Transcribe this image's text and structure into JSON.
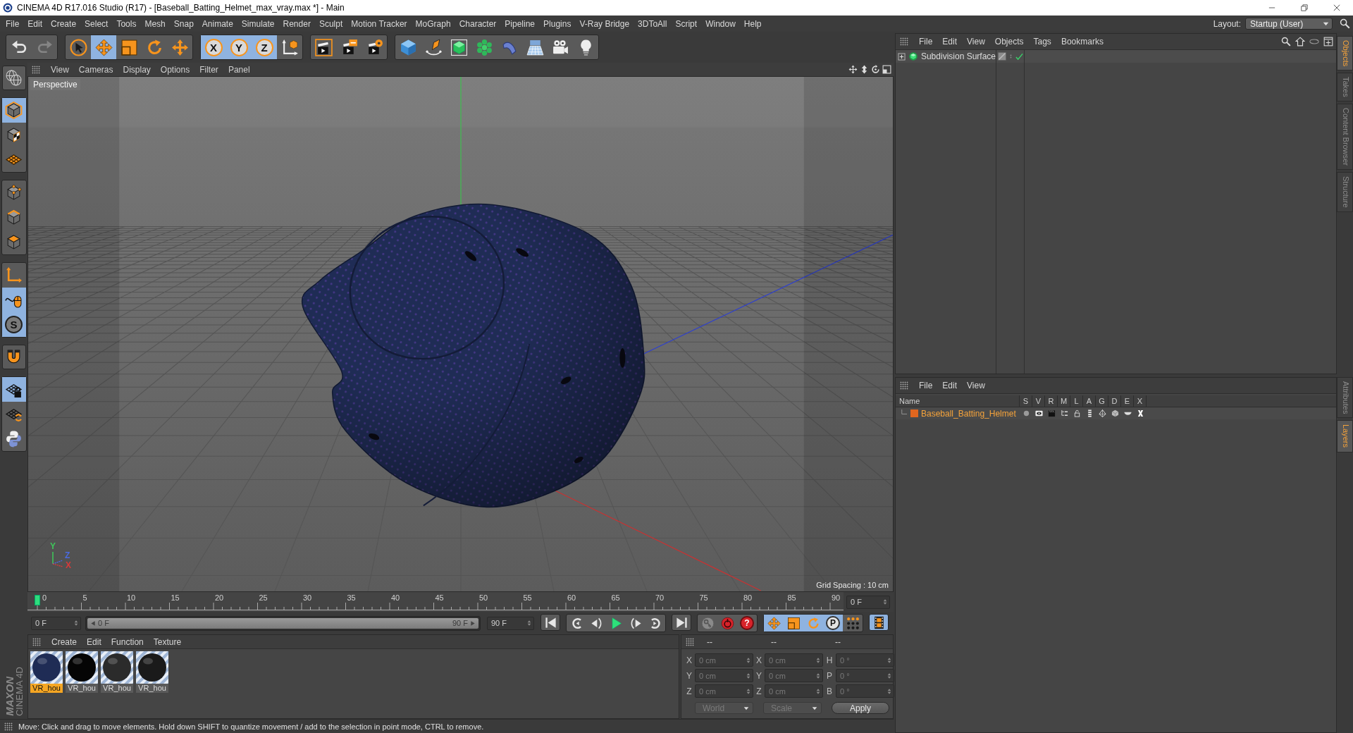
{
  "window": {
    "title": "CINEMA 4D R17.016 Studio (R17) - [Baseball_Batting_Helmet_max_vray.max *] - Main"
  },
  "menu_bar": {
    "items": [
      "File",
      "Edit",
      "Create",
      "Select",
      "Tools",
      "Mesh",
      "Snap",
      "Animate",
      "Simulate",
      "Render",
      "Sculpt",
      "Motion Tracker",
      "MoGraph",
      "Character",
      "Pipeline",
      "Plugins",
      "V-Ray Bridge",
      "3DToAll",
      "Script",
      "Window",
      "Help"
    ],
    "layout_label": "Layout:",
    "layout_value": "Startup (User)"
  },
  "toolbar": {
    "groups": [
      [
        {
          "kind": "undo",
          "selected": false,
          "disabled": false
        },
        {
          "kind": "redo",
          "selected": false,
          "disabled": true
        }
      ],
      [
        {
          "kind": "select",
          "selected": false,
          "disabled": false
        },
        {
          "kind": "move",
          "selected": true,
          "disabled": false
        },
        {
          "kind": "scale",
          "selected": false,
          "disabled": false
        },
        {
          "kind": "rotate",
          "selected": false,
          "disabled": false
        },
        {
          "kind": "transform",
          "selected": false,
          "disabled": false
        }
      ],
      [
        {
          "kind": "axis_x",
          "label": "X",
          "selected": true,
          "disabled": false
        },
        {
          "kind": "axis_y",
          "label": "Y",
          "selected": true,
          "disabled": false
        },
        {
          "kind": "axis_z",
          "label": "Z",
          "selected": true,
          "disabled": false
        },
        {
          "kind": "coords",
          "selected": false,
          "disabled": false
        }
      ],
      [
        {
          "kind": "render_view",
          "selected": false,
          "disabled": false
        },
        {
          "kind": "render_pv",
          "selected": false,
          "disabled": false
        },
        {
          "kind": "render_settings",
          "selected": false,
          "disabled": false
        }
      ],
      [
        {
          "kind": "cube",
          "selected": false,
          "disabled": false
        },
        {
          "kind": "pen",
          "selected": false,
          "disabled": false
        },
        {
          "kind": "subdivision",
          "selected": false,
          "disabled": false
        },
        {
          "kind": "cloner",
          "selected": false,
          "disabled": false
        },
        {
          "kind": "bend",
          "selected": false,
          "disabled": false
        },
        {
          "kind": "floor",
          "selected": false,
          "disabled": false
        },
        {
          "kind": "camera",
          "selected": false,
          "disabled": false
        },
        {
          "kind": "light",
          "selected": false,
          "disabled": false
        }
      ]
    ]
  },
  "left_toolbar": {
    "groups": [
      [
        {
          "kind": "world",
          "selected": false
        }
      ],
      [
        {
          "kind": "model",
          "selected": true
        },
        {
          "kind": "texture",
          "selected": false
        },
        {
          "kind": "workplane",
          "selected": false
        }
      ],
      [
        {
          "kind": "points",
          "selected": false
        },
        {
          "kind": "edges",
          "selected": false
        },
        {
          "kind": "polygons",
          "selected": false
        }
      ],
      [
        {
          "kind": "axis",
          "selected": false
        },
        {
          "kind": "tweak",
          "selected": true
        },
        {
          "kind": "snap",
          "label": "S",
          "selected": true
        }
      ],
      [
        {
          "kind": "magnet",
          "selected": false
        }
      ],
      [
        {
          "kind": "grid_lock",
          "selected": true
        },
        {
          "kind": "grid_sync",
          "selected": false
        },
        {
          "kind": "python",
          "selected": false
        }
      ]
    ]
  },
  "viewport": {
    "menu": [
      "View",
      "Cameras",
      "Display",
      "Options",
      "Filter",
      "Panel"
    ],
    "camera_label": "Perspective",
    "gizmo_labels": [
      "Y",
      "Z",
      "X"
    ],
    "grid_spacing": "Grid Spacing : 10 cm"
  },
  "timeline": {
    "labels": [
      "0",
      "5",
      "10",
      "15",
      "20",
      "25",
      "30",
      "35",
      "40",
      "45",
      "50",
      "55",
      "60",
      "65",
      "70",
      "75",
      "80",
      "85",
      "90"
    ],
    "playhead": {
      "level": 0
    },
    "current_frame": "0 F"
  },
  "playback": {
    "start_field": "0 F",
    "range": {
      "start": "0 F",
      "end": "90 F",
      "level": 1
    },
    "end_field": "90 F",
    "groups": [
      [
        {
          "kind": "first",
          "selected": false
        }
      ],
      [
        {
          "kind": "prev_key",
          "selected": false
        },
        {
          "kind": "prev_frame",
          "selected": false
        },
        {
          "kind": "play",
          "selected": false
        },
        {
          "kind": "next_frame",
          "selected": false
        },
        {
          "kind": "next_key",
          "selected": false
        }
      ],
      [
        {
          "kind": "last",
          "selected": false
        }
      ],
      [
        {
          "kind": "key_off",
          "selected": false
        },
        {
          "kind": "record",
          "selected": false
        },
        {
          "kind": "autokey",
          "label": "?",
          "selected": false
        }
      ],
      [
        {
          "kind": "key_move",
          "selected": true
        },
        {
          "kind": "key_scale",
          "selected": true
        },
        {
          "kind": "key_rotate",
          "selected": true
        },
        {
          "kind": "param",
          "label": "P",
          "selected": true
        },
        {
          "kind": "pla",
          "selected": false
        }
      ],
      [
        {
          "kind": "timeline",
          "selected": true
        }
      ]
    ]
  },
  "materials": {
    "menu": [
      "Create",
      "Edit",
      "Function",
      "Texture"
    ],
    "items": [
      {
        "name": "VR_hou",
        "color": "#1f2c55",
        "selected": true
      },
      {
        "name": "VR_hou",
        "color": "#050505",
        "selected": false
      },
      {
        "name": "VR_hou",
        "color": "#2b2b2b",
        "selected": false
      },
      {
        "name": "VR_hou",
        "color": "#1a1a1a",
        "selected": false
      }
    ]
  },
  "coordinates": {
    "headers": [
      "--",
      "--",
      "--"
    ],
    "disabled": true,
    "rows": [
      [
        {
          "label": "X",
          "value": "0 cm"
        },
        {
          "label": "X",
          "value": "0 cm"
        },
        {
          "label": "H",
          "value": "0 °"
        }
      ],
      [
        {
          "label": "Y",
          "value": "0 cm"
        },
        {
          "label": "Y",
          "value": "0 cm"
        },
        {
          "label": "P",
          "value": "0 °"
        }
      ],
      [
        {
          "label": "Z",
          "value": "0 cm"
        },
        {
          "label": "Z",
          "value": "0 cm"
        },
        {
          "label": "B",
          "value": "0 °"
        }
      ]
    ],
    "dropdowns": [
      "World",
      "Scale"
    ],
    "apply": "Apply"
  },
  "object_manager": {
    "menu": [
      "File",
      "Edit",
      "View",
      "Objects",
      "Tags",
      "Bookmarks"
    ],
    "objects": [
      {
        "name": "Subdivision Surface",
        "selected": false,
        "expanded": false,
        "enabled": true
      }
    ]
  },
  "layer_manager": {
    "menu": [
      "File",
      "Edit",
      "View"
    ],
    "columns": [
      "Name",
      "S",
      "V",
      "R",
      "M",
      "L",
      "A",
      "G",
      "D",
      "E",
      "X"
    ],
    "layers": [
      {
        "name": "Baseball_Batting_Helmet",
        "color": "#e0661f",
        "selected": true
      }
    ]
  },
  "right_tabs": {
    "top": [
      {
        "label": "Objects",
        "selected": true
      },
      {
        "label": "Takes",
        "selected": false
      },
      {
        "label": "Content Browser",
        "selected": false
      },
      {
        "label": "Structure",
        "selected": false
      }
    ],
    "bottom": [
      {
        "label": "Attributes",
        "selected": false
      },
      {
        "label": "Layers",
        "selected": true
      }
    ]
  },
  "branding": {
    "company": "MAXON",
    "product": "CINEMA 4D"
  },
  "status_bar": {
    "text": "Move: Click and drag to move elements. Hold down SHIFT to quantize movement / add to the selection in point mode, CTRL to remove."
  }
}
